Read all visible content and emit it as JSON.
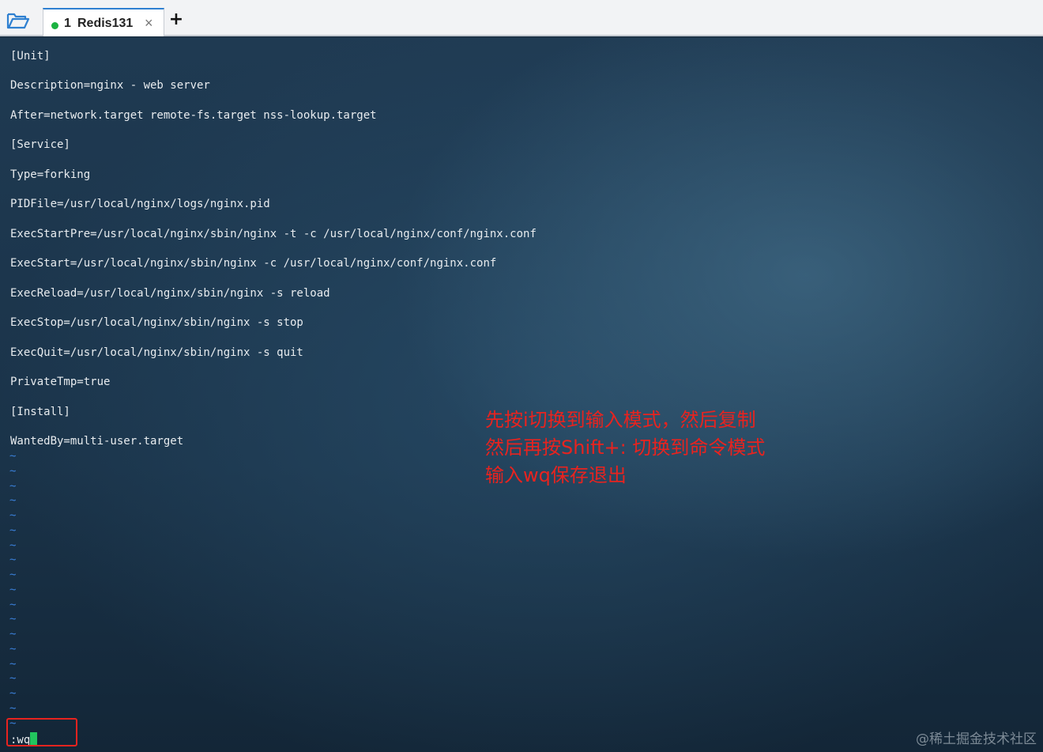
{
  "tabbar": {
    "folder_icon": "folder-open-icon",
    "tab": {
      "number": "1",
      "title": "Redis131",
      "close": "×",
      "status_color": "#1bb241"
    },
    "add_tab": "+"
  },
  "terminal": {
    "lines": [
      "[Unit]",
      "Description=nginx - web server",
      "After=network.target remote-fs.target nss-lookup.target",
      "[Service]",
      "Type=forking",
      "PIDFile=/usr/local/nginx/logs/nginx.pid",
      "ExecStartPre=/usr/local/nginx/sbin/nginx -t -c /usr/local/nginx/conf/nginx.conf",
      "ExecStart=/usr/local/nginx/sbin/nginx -c /usr/local/nginx/conf/nginx.conf",
      "ExecReload=/usr/local/nginx/sbin/nginx -s reload",
      "ExecStop=/usr/local/nginx/sbin/nginx -s stop",
      "ExecQuit=/usr/local/nginx/sbin/nginx -s quit",
      "PrivateTmp=true",
      "[Install]",
      "WantedBy=multi-user.target"
    ],
    "tilde": "~",
    "command": ":wq",
    "cursor_color": "#22c55e"
  },
  "annotation": {
    "lines": [
      "先按i切换到输入模式，然后复制",
      "然后再按Shift+: 切换到命令模式",
      "输入wq保存退出"
    ],
    "color": "#e8231f"
  },
  "watermark": "@稀土掘金技术社区"
}
